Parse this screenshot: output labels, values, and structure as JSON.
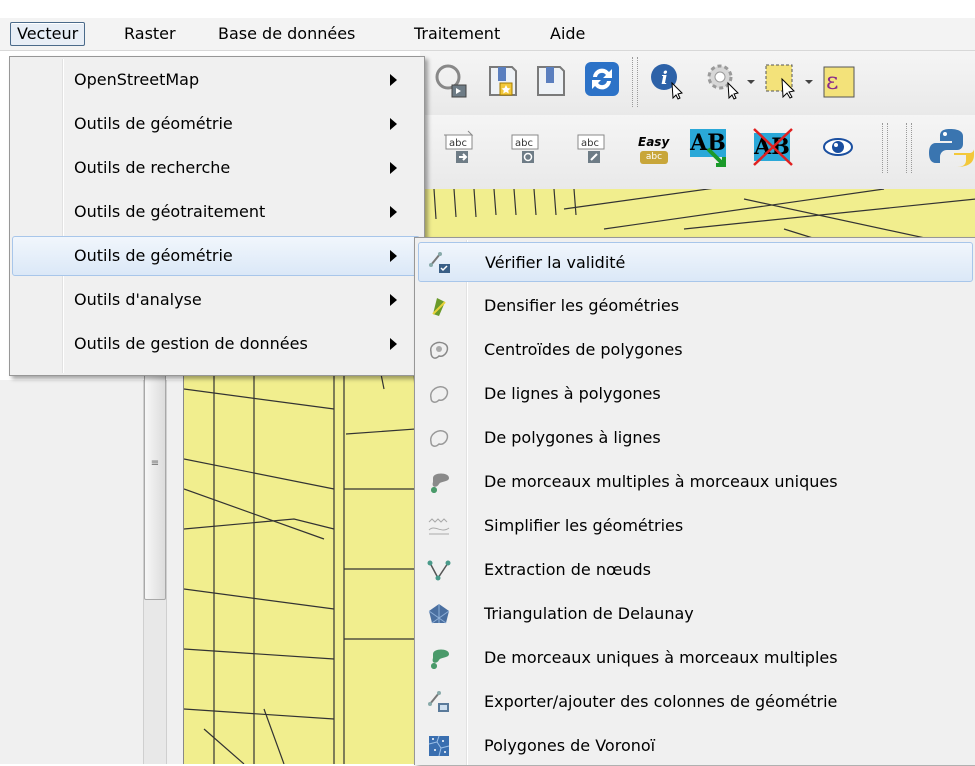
{
  "menubar": {
    "items": [
      {
        "label": "Vecteur"
      },
      {
        "label": "Raster"
      },
      {
        "label": "Base de données"
      },
      {
        "label": "Traitement"
      },
      {
        "label": "Aide"
      }
    ]
  },
  "vector_menu": {
    "items": [
      {
        "label": "OpenStreetMap"
      },
      {
        "label": "Outils de géométrie"
      },
      {
        "label": "Outils de recherche"
      },
      {
        "label": "Outils de géotraitement"
      },
      {
        "label": "Outils de géométrie"
      },
      {
        "label": "Outils d'analyse"
      },
      {
        "label": "Outils de gestion de données"
      }
    ]
  },
  "geometry_submenu": {
    "items": [
      {
        "label": "Vérifier la validité",
        "icon": "check-validity-icon"
      },
      {
        "label": "Densifier les géométries",
        "icon": "densify-icon"
      },
      {
        "label": "Centroïdes de polygones",
        "icon": "centroids-icon"
      },
      {
        "label": "De lignes à polygones",
        "icon": "lines-to-polygons-icon"
      },
      {
        "label": "De polygones à lignes",
        "icon": "polygons-to-lines-icon"
      },
      {
        "label": "De morceaux multiples à morceaux uniques",
        "icon": "multipart-to-single-icon"
      },
      {
        "label": "Simplifier les géométries",
        "icon": "simplify-icon"
      },
      {
        "label": "Extraction de nœuds",
        "icon": "extract-nodes-icon"
      },
      {
        "label": "Triangulation de Delaunay",
        "icon": "delaunay-icon"
      },
      {
        "label": "De morceaux uniques à morceaux multiples",
        "icon": "single-to-multipart-icon"
      },
      {
        "label": "Exporter/ajouter des colonnes de géométrie",
        "icon": "export-geometry-columns-icon"
      },
      {
        "label": "Polygones de Voronoï",
        "icon": "voronoi-icon"
      }
    ]
  },
  "toolbar2": {
    "easy_label": "Easy",
    "easy_sub": "abc",
    "ab_label": "AB"
  },
  "colors": {
    "map_fill": "#f1ee8e",
    "highlight": "#dbe8f7",
    "highlight_border": "#a8c6ea"
  }
}
